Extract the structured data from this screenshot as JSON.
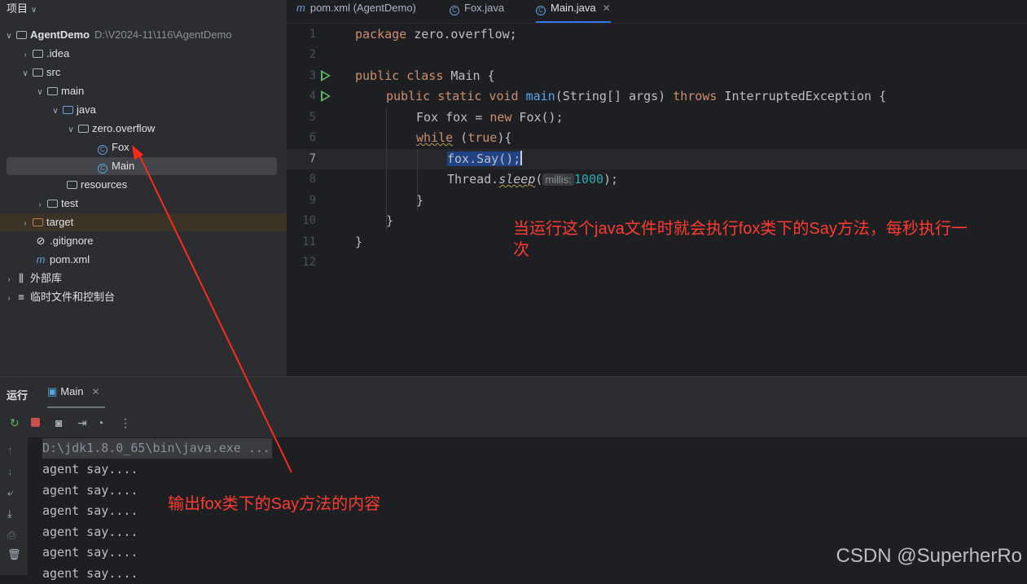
{
  "project": {
    "header": "项目",
    "tree": [
      {
        "label": "AgentDemo",
        "path": "D:\\V2024-11\\116\\AgentDemo",
        "icon": "module-folder-icon"
      },
      {
        "label": ".idea",
        "icon": "folder-icon"
      },
      {
        "label": "src",
        "icon": "folder-icon"
      },
      {
        "label": "main",
        "icon": "folder-icon"
      },
      {
        "label": "java",
        "icon": "source-folder-icon"
      },
      {
        "label": "zero.overflow",
        "icon": "package-icon"
      },
      {
        "label": "Fox",
        "icon": "class-icon"
      },
      {
        "label": "Main",
        "icon": "runnable-class-icon"
      },
      {
        "label": "resources",
        "icon": "resources-folder-icon"
      },
      {
        "label": "test",
        "icon": "folder-icon"
      },
      {
        "label": "target",
        "icon": "excluded-folder-icon"
      },
      {
        "label": ".gitignore",
        "icon": "ignored-file-icon"
      },
      {
        "label": "pom.xml",
        "icon": "maven-icon"
      },
      {
        "label": "外部库",
        "icon": "library-icon"
      },
      {
        "label": "临时文件和控制台",
        "icon": "scratches-icon"
      }
    ]
  },
  "editor": {
    "tabs": [
      {
        "label": "pom.xml (AgentDemo)",
        "icon": "maven-icon"
      },
      {
        "label": "Fox.java",
        "icon": "class-icon"
      },
      {
        "label": "Main.java",
        "icon": "runnable-class-icon",
        "active": true
      }
    ],
    "line_numbers": [
      "1",
      "2",
      "3",
      "4",
      "5",
      "6",
      "7",
      "8",
      "9",
      "10",
      "11",
      "12"
    ],
    "current_line": "7",
    "code": {
      "l1_kw": "package",
      "l1_rest": " zero.overflow;",
      "l3_kw": "public class",
      "l3_rest": " Main {",
      "l4_kw1": "public static void",
      "l4_fn": "main",
      "l4_mid": "(String[] args) ",
      "l4_kw2": "throws",
      "l4_rest": " InterruptedException {",
      "l5_a": "Fox fox = ",
      "l5_kw": "new",
      "l5_b": " Fox();",
      "l6_kw1": "while",
      "l6_a": " (",
      "l6_kw2": "true",
      "l6_b": "){",
      "l7_sel": "fox.Say();",
      "l8_a": "Thread.",
      "l8_fn": "sleep",
      "l8_b": "(",
      "l8_hint": "millis:",
      "l8_num": "1000",
      "l8_c": ");",
      "l9": "}",
      "l10": "}",
      "l11": "}"
    }
  },
  "annotations": {
    "editor_note": "当运行这个java文件时就会执行fox类下的Say方法，每秒执行一次",
    "console_note": "输出fox类下的Say方法的内容",
    "color": "#ff3b2f"
  },
  "run": {
    "title": "运行",
    "tab": "Main",
    "output": [
      "D:\\jdk1.8.0_65\\bin\\java.exe ...",
      "agent say....",
      "agent say....",
      "agent say....",
      "agent say....",
      "agent say....",
      "agent say...."
    ]
  },
  "watermark": "CSDN @SuperherRo"
}
